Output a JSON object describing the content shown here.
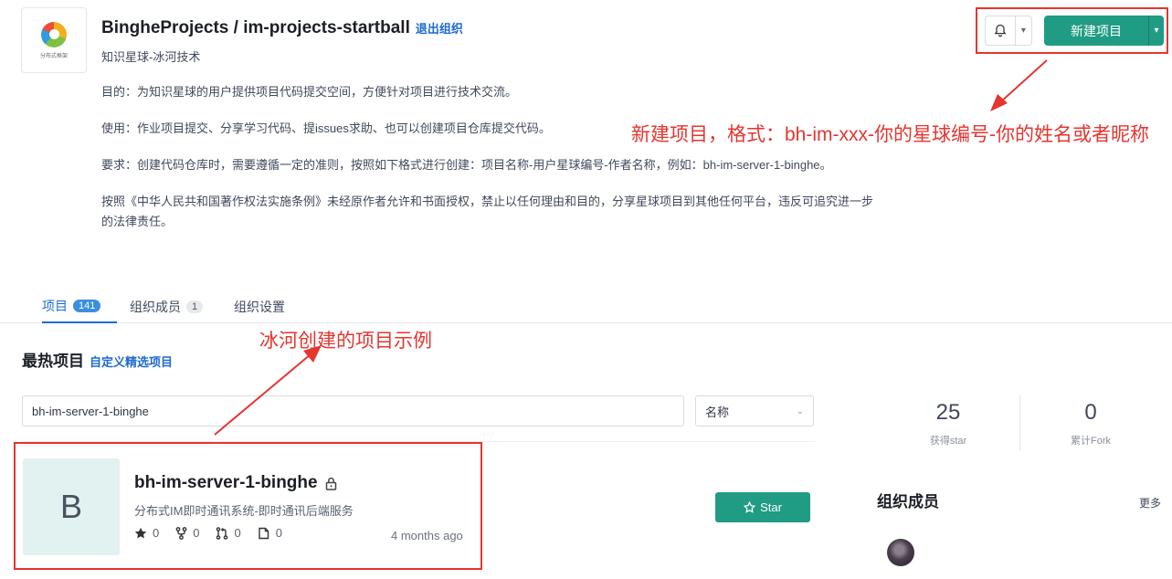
{
  "org": {
    "logo_text": "分布式框架",
    "name": "BingheProjects / im-projects-startball",
    "exit_label": "退出组织",
    "subtitle": "知识星球-冰河技术",
    "description": [
      "目的：为知识星球的用户提供项目代码提交空间，方便针对项目进行技术交流。",
      "使用：作业项目提交、分享学习代码、提issues求助、也可以创建项目仓库提交代码。",
      "要求：创建代码仓库时，需要遵循一定的准则，按照如下格式进行创建：项目名称-用户星球编号-作者名称，例如：bh-im-server-1-binghe。",
      "按照《中华人民共和国著作权法实施条例》未经原作者允许和书面授权，禁止以任何理由和目的，分享星球项目到其他任何平台，违反可追究进一步的法律责任。"
    ]
  },
  "toolbar": {
    "bell_icon": "bell-icon",
    "new_project_label": "新建项目"
  },
  "annotations": {
    "new_project_note": "新建项目，格式：bh-im-xxx-你的星球编号-你的姓名或者昵称",
    "example_note": "冰河创建的项目示例",
    "color": "#e5352f"
  },
  "tabs": [
    {
      "label": "项目",
      "count": "141",
      "active": true
    },
    {
      "label": "组织成员",
      "count": "1",
      "active": false
    },
    {
      "label": "组织设置",
      "count": "",
      "active": false
    }
  ],
  "hot": {
    "title": "最热项目",
    "customize_link": "自定义精选项目"
  },
  "filter": {
    "search_value": "bh-im-server-1-binghe",
    "sort_value": "名称"
  },
  "project": {
    "avatar_letter": "B",
    "name": "bh-im-server-1-binghe",
    "description": "分布式IM即时通讯系统-即时通讯后端服务",
    "stars": "0",
    "forks": "0",
    "pull_requests": "0",
    "issues": "0",
    "updated": "4 months ago",
    "star_button": "Star"
  },
  "sidebar": {
    "stats": [
      {
        "value": "25",
        "label": "获得star"
      },
      {
        "value": "0",
        "label": "累计Fork"
      }
    ],
    "members_title": "组织成员",
    "more_label": "更多"
  },
  "colors": {
    "primary": "#1f9c83",
    "link": "#1e6bd0",
    "avatar_bg": "#e2f2f1"
  }
}
